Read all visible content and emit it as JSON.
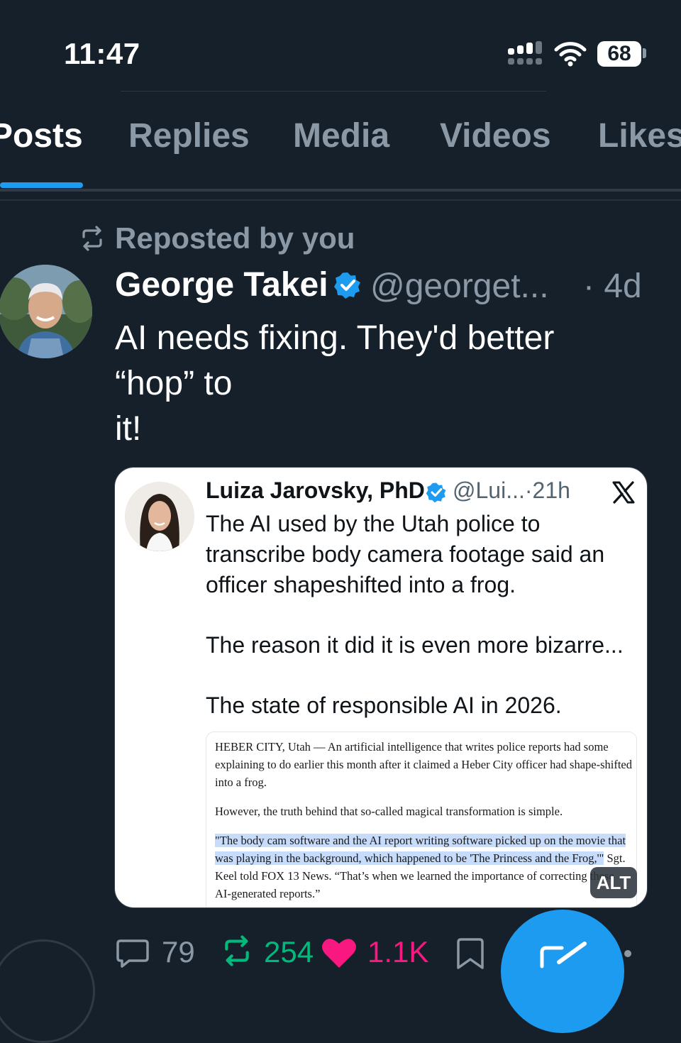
{
  "status_bar": {
    "time": "11:47",
    "battery": "68"
  },
  "tabs": [
    {
      "label": "Posts",
      "active": true
    },
    {
      "label": "Replies",
      "active": false
    },
    {
      "label": "Media",
      "active": false
    },
    {
      "label": "Videos",
      "active": false
    },
    {
      "label": "Likes",
      "active": false
    }
  ],
  "post": {
    "repost_label": "Reposted by you",
    "author": "George Takei",
    "handle": "@georget...",
    "time": "· 4d",
    "text_lines": [
      "AI needs fixing. They'd better",
      "“hop” to",
      "it!"
    ]
  },
  "quoted_image": {
    "author": "Luiza Jarovsky, PhD",
    "handle": "@Lui...·21h",
    "para1": "The AI used by the Utah police to transcribe body camera footage said an officer shapeshifted into a frog.",
    "para2": "The reason it did it is even more bizarre...",
    "para3": "The state of responsible AI in 2026.",
    "article_p1": "HEBER CITY, Utah — An artificial intelligence that writes police reports had some explaining to do earlier this month after it claimed a Heber City officer had shape-shifted into a frog.",
    "article_p2": "However, the truth behind that so-called magical transformation is simple.",
    "article_p3_highlight": "\"The body cam software and the AI report writing software picked up on the movie that was playing in the background, which happened to be 'The Princess and the Frog,'\"",
    "article_p3_rest": " Sgt. Keel told FOX 13 News. “That’s when we learned the importance of correcting these AI-generated reports.”",
    "alt_label": "ALT"
  },
  "actions": {
    "replies": "79",
    "reposts": "254",
    "likes": "1.1K"
  },
  "colors": {
    "background": "#15202b",
    "accent": "#1d9bf0",
    "repost_green": "#00ba7c",
    "like_pink": "#f91880",
    "muted": "#8b98a5"
  }
}
